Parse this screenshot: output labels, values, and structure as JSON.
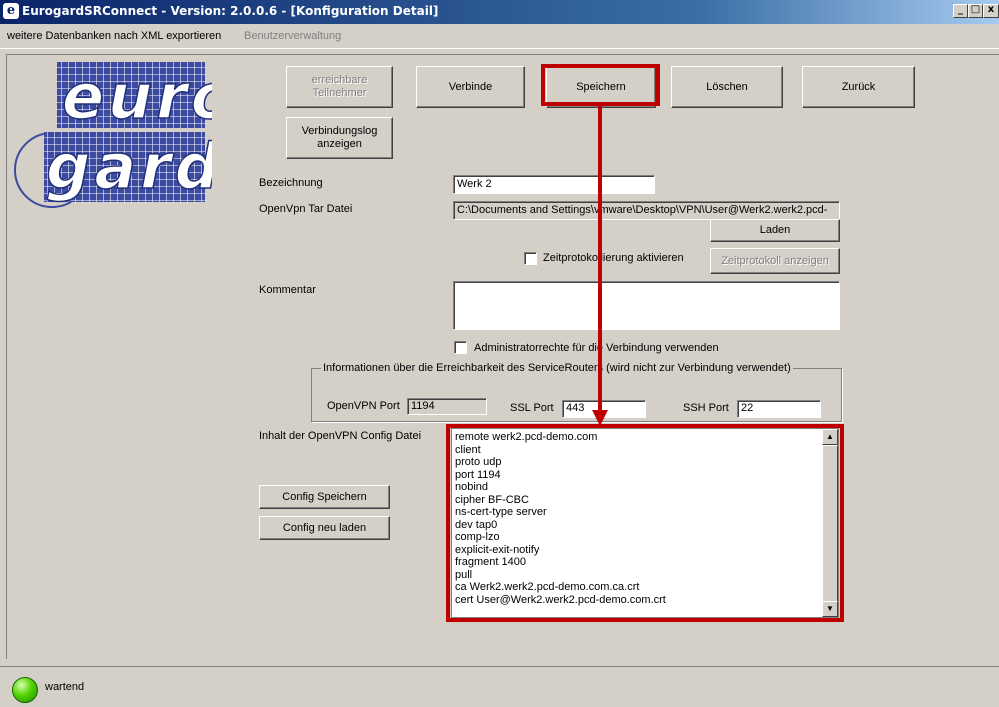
{
  "window": {
    "icon_letter": "e",
    "title": "EurogardSRConnect - Version: 2.0.0.6 - [Konfiguration Detail]",
    "controls": {
      "minimize": "_",
      "maximize": "□",
      "close": "x"
    }
  },
  "menu": {
    "items": [
      {
        "label": "weitere Datenbanken nach XML exportieren"
      },
      {
        "label": "Benutzerverwaltung"
      }
    ]
  },
  "logo": {
    "text_top": "euro",
    "text_bottom": "gard"
  },
  "toolbar": {
    "erreichbare_line1": "erreichbare",
    "erreichbare_line2": "Teilnehmer",
    "verbinde": "Verbinde",
    "speichern": "Speichern",
    "loeschen": "Löschen",
    "zurueck": "Zurück",
    "verbindungslog_line1": "Verbindungslog",
    "verbindungslog_line2": "anzeigen"
  },
  "form": {
    "bezeichnung_label": "Bezeichnung",
    "bezeichnung_value": "Werk 2",
    "openvpn_tar_label": "OpenVpn Tar Datei",
    "openvpn_tar_value": "C:\\Documents and Settings\\vmware\\Desktop\\VPN\\User@Werk2.werk2.pcd-",
    "laden_button": "Laden",
    "zeitprotokoll_checkbox": "Zeitprotokollierung aktivieren",
    "zeitprotokoll_button": "Zeitprotokoll anzeigen",
    "kommentar_label": "Kommentar",
    "kommentar_value": "",
    "admin_checkbox": "Administratorrechte für die Verbindung verwenden"
  },
  "group": {
    "title": "Informationen über die Erreichbarkeit des ServiceRouters (wird nicht zur Verbindung verwendet)",
    "openvpn_port_label": "OpenVPN Port",
    "openvpn_port_value": "1194",
    "ssl_port_label": "SSL Port",
    "ssl_port_value": "443",
    "ssh_port_label": "SSH Port",
    "ssh_port_value": "22"
  },
  "config": {
    "label": "Inhalt der OpenVPN Config Datei",
    "save_button": "Config Speichern",
    "reload_button": "Config neu laden",
    "lines": [
      "remote werk2.pcd-demo.com",
      "client",
      "proto udp",
      "port 1194",
      "nobind",
      "cipher BF-CBC",
      "ns-cert-type server",
      "dev tap0",
      "comp-lzo",
      "explicit-exit-notify",
      "fragment 1400",
      "pull",
      "ca Werk2.werk2.pcd-demo.com.ca.crt",
      "cert User@Werk2.werk2.pcd-demo.com.crt"
    ]
  },
  "status": {
    "text": "wartend",
    "led_color": "#54d400"
  },
  "colors": {
    "highlight": "#c00000",
    "titlebar": "#0a246a",
    "window_bg": "#d4d0c8"
  }
}
